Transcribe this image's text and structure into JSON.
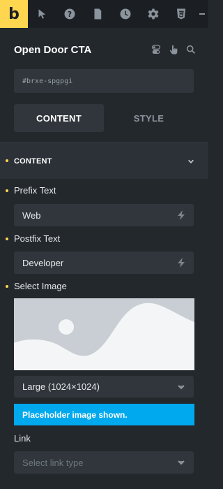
{
  "toolbar": {
    "logo": "b",
    "icons": [
      "cursor-icon",
      "help-icon",
      "page-icon",
      "history-icon",
      "gear-icon",
      "css3-icon"
    ]
  },
  "header": {
    "title": "Open Door CTA",
    "element_id": "#brxe-spgpgi"
  },
  "tabs": {
    "content": "CONTENT",
    "style": "STYLE",
    "active": "content"
  },
  "section": {
    "title": "CONTENT"
  },
  "fields": {
    "prefix": {
      "label": "Prefix Text",
      "value": "Web"
    },
    "postfix": {
      "label": "Postfix Text",
      "value": "Developer"
    },
    "image": {
      "label": "Select Image",
      "size_value": "Large (1024×1024)"
    },
    "notice": "Placeholder image shown.",
    "link": {
      "label": "Link",
      "placeholder": "Select link type"
    }
  },
  "colors": {
    "accent": "#ffd64f",
    "notice_bg": "#00a8ee",
    "panel_bg": "#23282d",
    "input_bg": "#30363b"
  }
}
